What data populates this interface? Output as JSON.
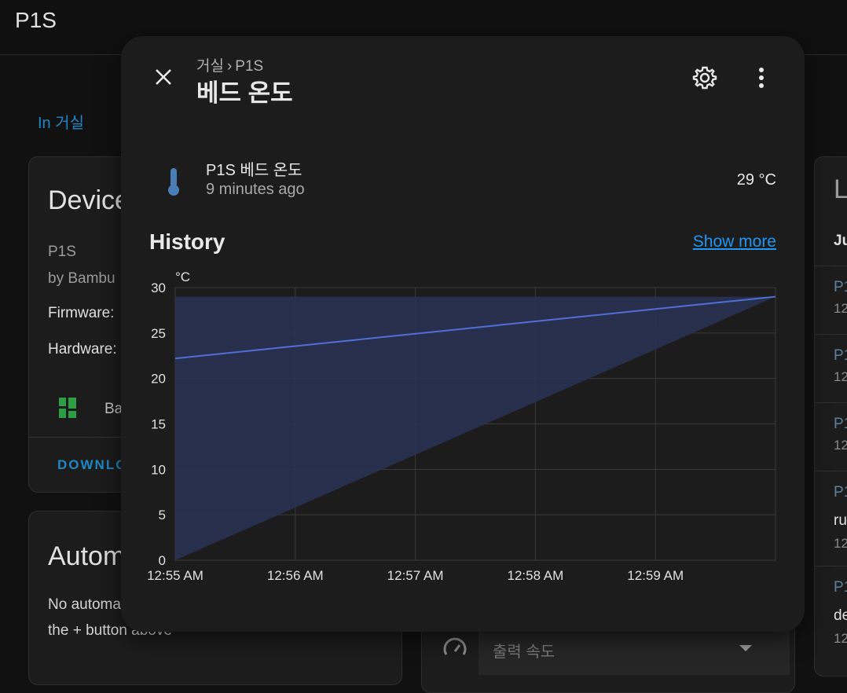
{
  "app": {
    "title": "P1S"
  },
  "page": {
    "area_link": "In 거실",
    "device_card": {
      "title": "Device",
      "model": "P1S",
      "manufacturer": "by Bambu",
      "firmware_label": "Firmware:",
      "hardware_label": "Hardware:",
      "brand_name": "Ba",
      "download_label": "DOWNLO"
    },
    "automation_card": {
      "title": "Autom",
      "description": "No automa device yet. You can add one by pressing the + button above"
    },
    "speed_card": {
      "label": "출력 속도"
    },
    "logbook_card": {
      "title": "L",
      "date": "Ju",
      "entries": [
        {
          "l1": "P1",
          "l2": "12"
        },
        {
          "l1": "P1",
          "l2": "12"
        },
        {
          "l1": "P1",
          "l2": "12"
        },
        {
          "l1": "P1",
          "l2": "ru",
          "l3": "12"
        },
        {
          "l1": "P1",
          "l2": "de",
          "l3": "12"
        }
      ]
    }
  },
  "dialog": {
    "breadcrumb": [
      "거실",
      "P1S"
    ],
    "breadcrumb_separator": "›",
    "title": "베드 온도",
    "entity": {
      "name": "P1S 베드 온도",
      "last_changed": "9 minutes ago",
      "state": "29 °C",
      "icon": "thermometer-icon"
    },
    "history": {
      "title": "History",
      "show_more": "Show more"
    }
  },
  "colors": {
    "accent": "#1e88c7",
    "link": "#2196f3",
    "line": "#4f6fd6",
    "fill": "#2a3253",
    "dialog_bg": "#1c1c1c",
    "page_bg": "#111111"
  },
  "chart_data": {
    "type": "line",
    "ylabel": "°C",
    "ylim": [
      0,
      30
    ],
    "y_ticks": [
      0,
      5,
      10,
      15,
      20,
      25,
      30
    ],
    "x_ticks": [
      "12:55 AM",
      "12:56 AM",
      "12:57 AM",
      "12:58 AM",
      "12:59 AM"
    ],
    "xlim_minutes": [
      0,
      5
    ],
    "series": [
      {
        "points": [
          {
            "x": 0,
            "y": 22.2
          },
          {
            "x": 5,
            "y": 29
          }
        ]
      }
    ],
    "grid": true
  }
}
